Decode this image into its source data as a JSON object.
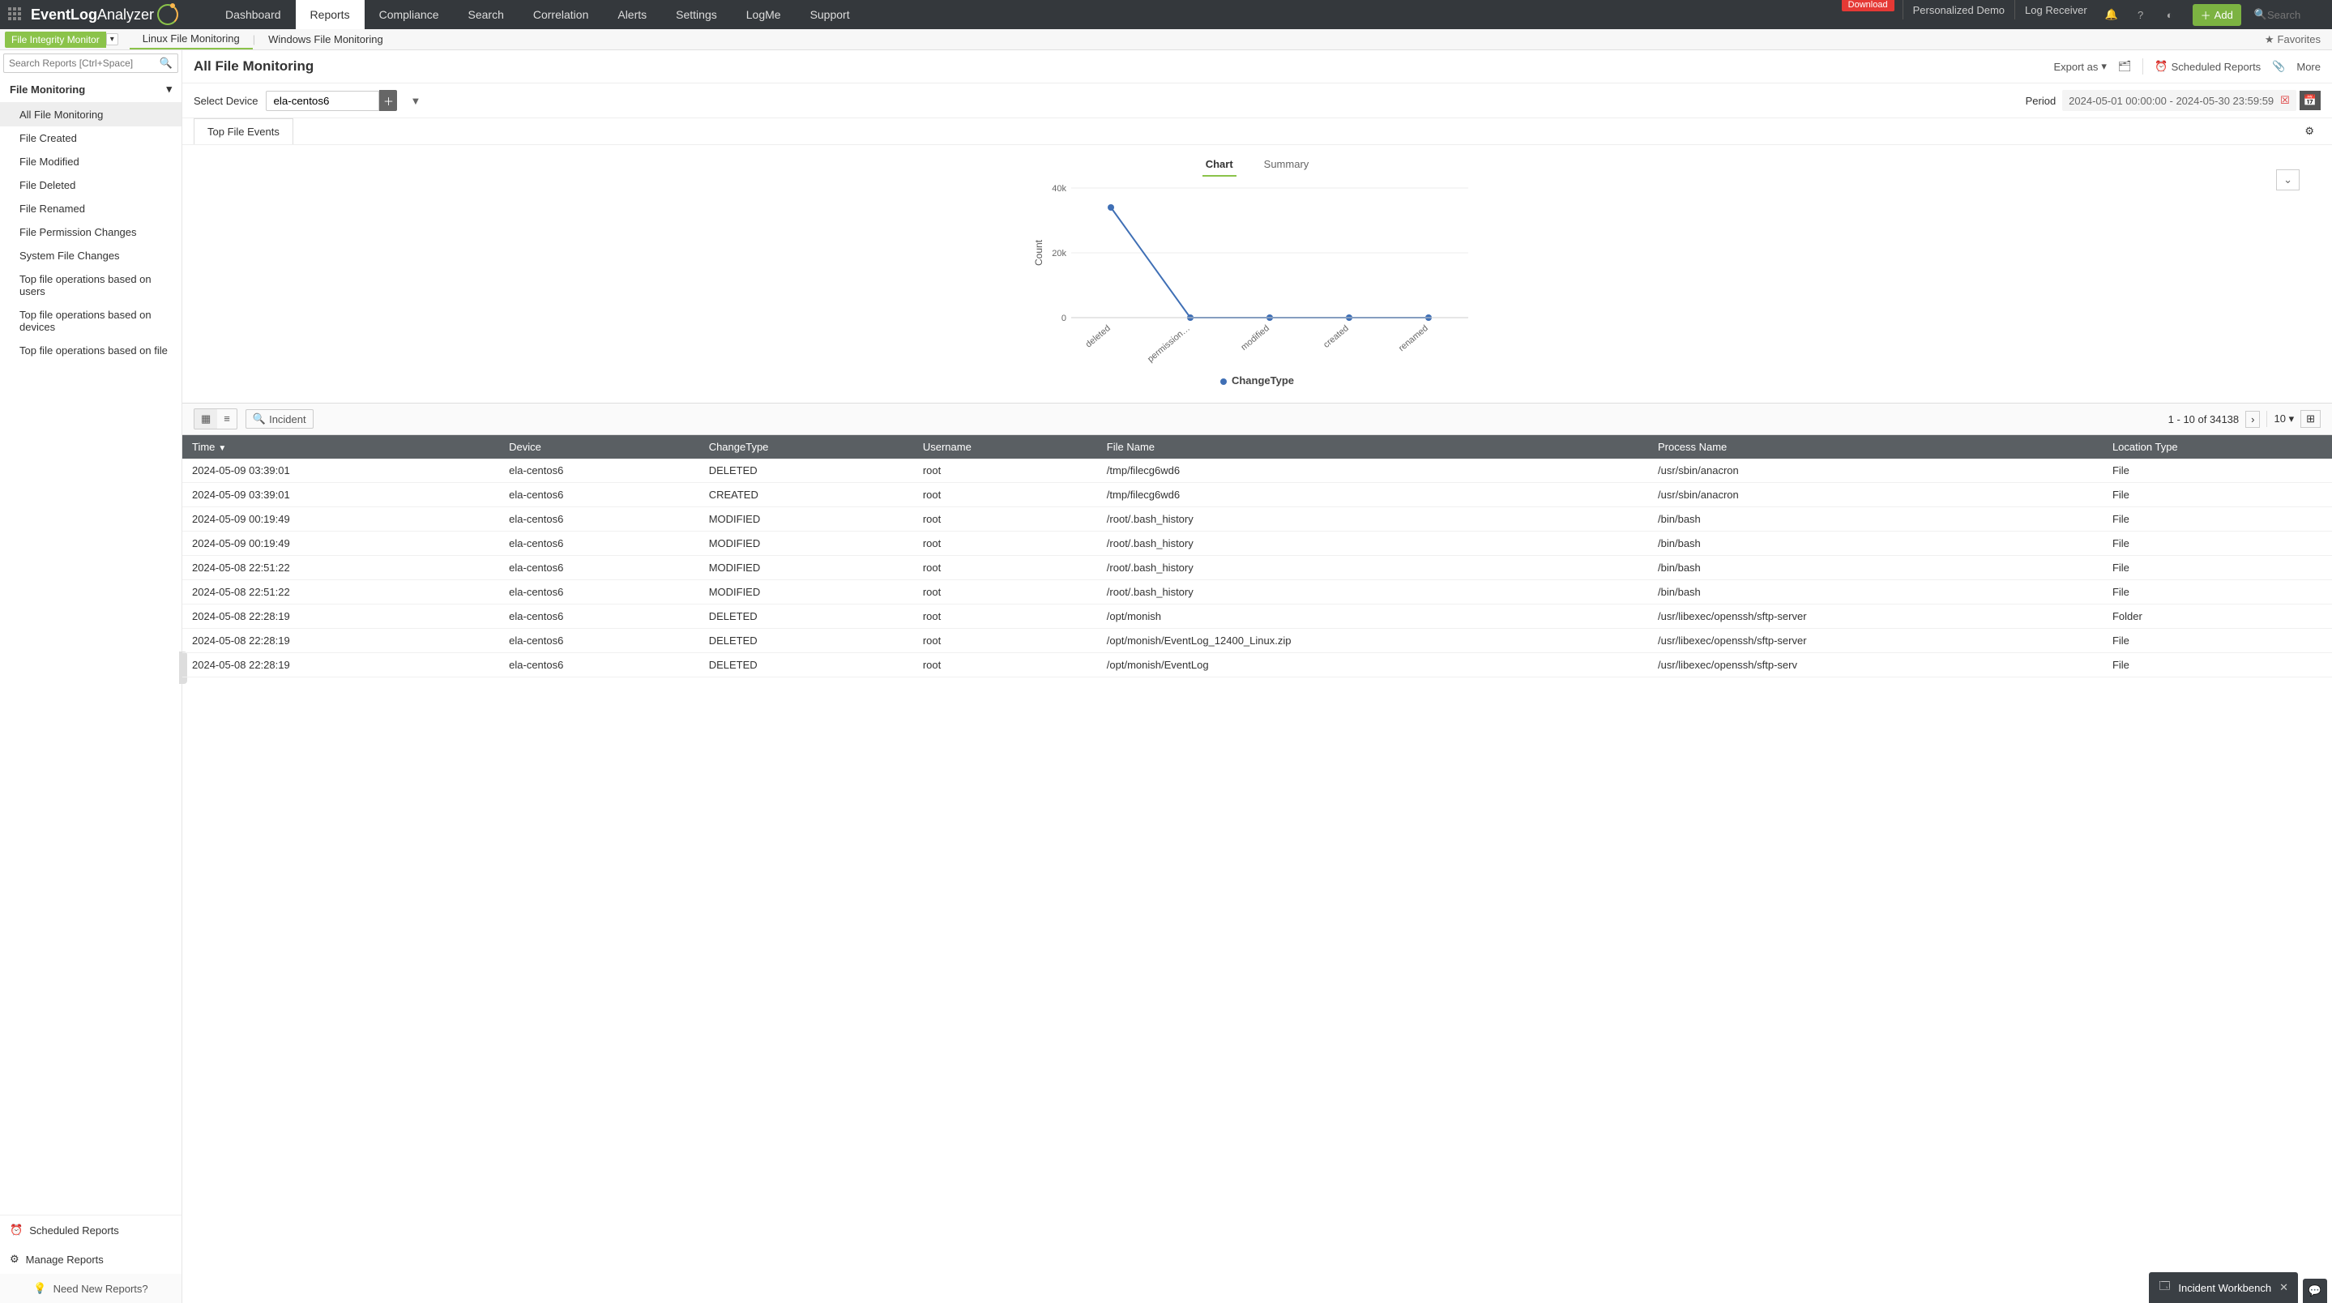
{
  "top": {
    "logo1": "EventLog",
    "logo2": " Analyzer",
    "nav": [
      "Dashboard",
      "Reports",
      "Compliance",
      "Search",
      "Correlation",
      "Alerts",
      "Settings",
      "LogMe",
      "Support"
    ],
    "nav_active": 1,
    "download": "Download",
    "demo": "Personalized Demo",
    "logrec": "Log Receiver",
    "add": "Add",
    "search_ph": "Search"
  },
  "sub": {
    "fim": "File Integrity Monitor",
    "links": [
      "Linux File Monitoring",
      "Windows File Monitoring"
    ],
    "active": 0,
    "fav": "Favorites"
  },
  "left": {
    "search_ph": "Search Reports [Ctrl+Space]",
    "section": "File Monitoring",
    "items": [
      "All File Monitoring",
      "File Created",
      "File Modified",
      "File Deleted",
      "File Renamed",
      "File Permission Changes",
      "System File Changes",
      "Top file operations based on users",
      "Top file operations based on devices",
      "Top file operations based on file"
    ],
    "active": 0,
    "sched": "Scheduled Reports",
    "manage": "Manage Reports",
    "need": "Need New Reports?"
  },
  "page": {
    "title": "All File Monitoring",
    "export": "Export as",
    "sched": "Scheduled Reports",
    "more": "More",
    "select_device": "Select Device",
    "device": "ela-centos6",
    "period_lbl": "Period",
    "period": "2024-05-01 00:00:00 - 2024-05-30 23:59:59",
    "tab": "Top File Events",
    "chart_tab": "Chart",
    "summary_tab": "Summary",
    "legend": "ChangeType"
  },
  "chart_data": {
    "type": "line",
    "categories": [
      "deleted",
      "permission…",
      "modified",
      "created",
      "renamed"
    ],
    "values": [
      34000,
      0,
      0,
      0,
      0
    ],
    "ylabel": "Count",
    "ylim": [
      0,
      40000
    ],
    "yticks": [
      "0",
      "20k",
      "40k"
    ]
  },
  "grid": {
    "incident": "Incident",
    "range": "1 - 10 of 34138",
    "page_size": "10",
    "cols": [
      "Time",
      "Device",
      "ChangeType",
      "Username",
      "File Name",
      "Process Name",
      "Location Type"
    ],
    "rows": [
      [
        "2024-05-09 03:39:01",
        "ela-centos6",
        "DELETED",
        "root",
        "/tmp/filecg6wd6",
        "/usr/sbin/anacron",
        "File"
      ],
      [
        "2024-05-09 03:39:01",
        "ela-centos6",
        "CREATED",
        "root",
        "/tmp/filecg6wd6",
        "/usr/sbin/anacron",
        "File"
      ],
      [
        "2024-05-09 00:19:49",
        "ela-centos6",
        "MODIFIED",
        "root",
        "/root/.bash_history",
        "/bin/bash",
        "File"
      ],
      [
        "2024-05-09 00:19:49",
        "ela-centos6",
        "MODIFIED",
        "root",
        "/root/.bash_history",
        "/bin/bash",
        "File"
      ],
      [
        "2024-05-08 22:51:22",
        "ela-centos6",
        "MODIFIED",
        "root",
        "/root/.bash_history",
        "/bin/bash",
        "File"
      ],
      [
        "2024-05-08 22:51:22",
        "ela-centos6",
        "MODIFIED",
        "root",
        "/root/.bash_history",
        "/bin/bash",
        "File"
      ],
      [
        "2024-05-08 22:28:19",
        "ela-centos6",
        "DELETED",
        "root",
        "/opt/monish",
        "/usr/libexec/openssh/sftp-server",
        "Folder"
      ],
      [
        "2024-05-08 22:28:19",
        "ela-centos6",
        "DELETED",
        "root",
        "/opt/monish/EventLog_12400_Linux.zip",
        "/usr/libexec/openssh/sftp-server",
        "File"
      ],
      [
        "2024-05-08 22:28:19",
        "ela-centos6",
        "DELETED",
        "root",
        "/opt/monish/EventLog",
        "/usr/libexec/openssh/sftp-serv",
        "File"
      ]
    ]
  },
  "iwb": "Incident Workbench"
}
